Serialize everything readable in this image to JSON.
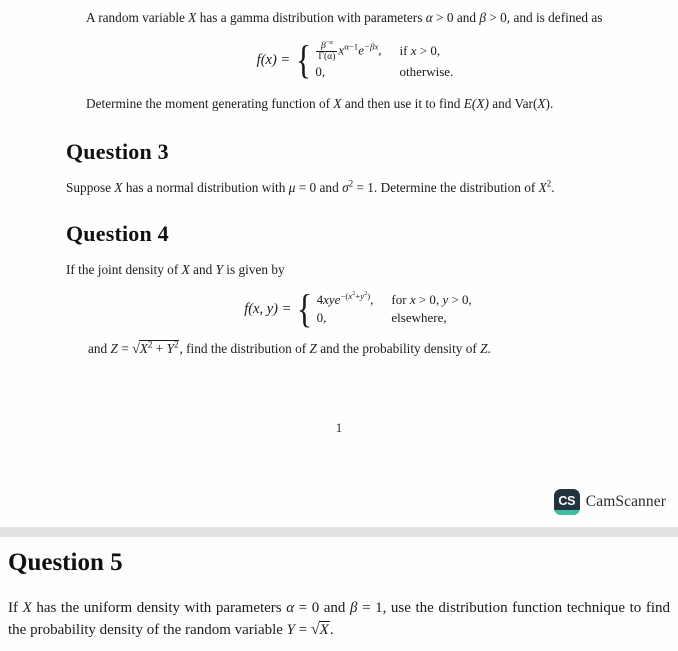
{
  "document": {
    "type": "scanned-worksheet",
    "pages": 2,
    "page_number_label": "1"
  },
  "page1": {
    "q2_continuation": {
      "line1_pre": "A random variable ",
      "var_x": "X",
      "line1_mid": " has a gamma distribution with parameters ",
      "alpha": "α",
      "gt1": " > 0 and ",
      "beta": "β",
      "gt2": " > 0, and is defined as",
      "full_text": "A random variable X has a gamma distribution with parameters α > 0 and β > 0, and is defined as"
    },
    "gamma_equation": {
      "lhs": "f(x) =",
      "case1_value_numerator": "β",
      "case1_value_num_exp": "−α",
      "case1_value_denominator": "Γ(α)",
      "case1_value_rest_base": "x",
      "case1_value_rest_exp": "α−1",
      "case1_value_exp_base": "e",
      "case1_value_exp_exp": "−βx",
      "case1_condition": "if x > 0,",
      "case2_value": "0,",
      "case2_condition": "otherwise.",
      "plain": "f(x) = { (β^-α / Γ(α)) x^(α-1) e^(-βx), if x > 0; 0, otherwise."
    },
    "q2_followup": {
      "pre": "Determine the moment generating function of ",
      "var_x": "X",
      "mid": " and then use it to find ",
      "ex": "E(X)",
      "and": " and ",
      "varx": "Var(X)",
      "end": ".",
      "full_text": "Determine the moment generating function of X and then use it to find E(X) and Var(X)."
    },
    "question3": {
      "heading": "Question 3",
      "body_pre": "Suppose ",
      "var_x": "X",
      "body_mid": " has a normal distribution with ",
      "mu": "μ",
      "mu_eq": " = 0 and ",
      "sigma": "σ",
      "sigma_exp": "2",
      "sigma_eq": " = 1. Determine the distribution of ",
      "x_sq_base": "X",
      "x_sq_exp": "2",
      "body_end": ".",
      "full_text": "Suppose X has a normal distribution with μ = 0 and σ² = 1. Determine the distribution of X²."
    },
    "question4": {
      "heading": "Question 4",
      "intro_pre": "If the joint density of ",
      "var_x": "X",
      "intro_mid": " and ",
      "var_y": "Y",
      "intro_end": " is given by",
      "intro_full": "If the joint density of X and Y is given by",
      "equation": {
        "lhs": "f(x, y) =",
        "case1_value_coef": "4xye",
        "case1_value_exp": "−(x²+y²)",
        "case1_value_tail": ",",
        "case1_condition": "for x > 0, y > 0,",
        "case2_value": "0,",
        "case2_condition": "elsewhere,",
        "plain": "f(x,y) = { 4xy e^(-(x²+y²)), for x > 0, y > 0; 0, elsewhere."
      },
      "closing_pre": "and ",
      "closing_z": "Z",
      "closing_eq": " = ",
      "closing_radicand_x": "X",
      "closing_radicand_xexp": "2",
      "closing_radicand_plus": " + ",
      "closing_radicand_y": "Y",
      "closing_radicand_yexp": "2",
      "closing_post": ", find the distribution of ",
      "closing_z2": "Z",
      "closing_end": " and the probability density of ",
      "closing_z3": "Z",
      "closing_period": ".",
      "closing_full": "and Z = √(X² + Y²), find the distribution of Z and the probability density of Z."
    },
    "watermark": {
      "badge_text": "CS",
      "brand": "CamScanner",
      "badge_color": "#22333f",
      "accent_color": "#3ebfa3"
    }
  },
  "page2": {
    "question5": {
      "heading": "Question 5",
      "body_pre": "If ",
      "var_x": "X",
      "body_p1": " has the uniform density with parameters ",
      "alpha": "α",
      "alpha_eq": " = 0 and ",
      "beta": "β",
      "beta_eq": " = 1, use the distribution function technique to find the probability density of the random variable ",
      "var_y": "Y",
      "y_eq": " = ",
      "radicand": "X",
      "body_end": ".",
      "full_text": "If X has the uniform density with parameters α = 0 and β = 1, use the distribution function technique to find the probability density of the random variable Y = √X."
    }
  }
}
